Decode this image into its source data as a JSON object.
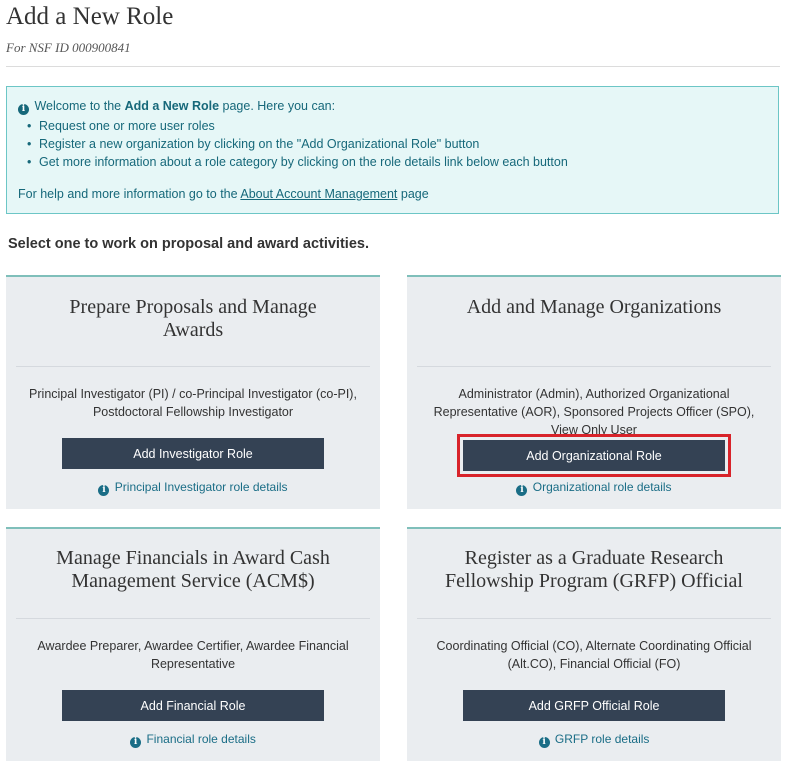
{
  "header": {
    "title": "Add a New Role",
    "subtitle": "For NSF ID 000900841"
  },
  "info": {
    "welcome_prefix": "Welcome to the ",
    "welcome_bold": "Add a New Role",
    "welcome_suffix": " page. Here you can:",
    "bullets": [
      "Request one or more user roles",
      "Register a new organization by clicking on the \"Add Organizational Role\" button",
      "Get more information about a role category by clicking on the role details link below each button"
    ],
    "help_prefix": "For help and more information go to the ",
    "help_link": "About Account Management",
    "help_suffix": " page",
    "icon": "info-circle-icon"
  },
  "section_heading": "Select one to work on proposal and award activities.",
  "cards": [
    {
      "title": "Prepare Proposals and Manage Awards",
      "description": "Principal Investigator (PI) / co-Principal Investigator (co-PI), Postdoctoral Fellowship Investigator",
      "button": "Add Investigator Role",
      "link": "Principal Investigator role details"
    },
    {
      "title": "Add and Manage Organizations",
      "description": "Administrator (Admin), Authorized Organizational Representative (AOR), Sponsored Projects Officer (SPO), View Only User",
      "button": "Add Organizational Role",
      "link": "Organizational role details"
    },
    {
      "title": "Manage Financials in Award Cash Management Service (ACM$)",
      "description": "Awardee Preparer, Awardee Certifier, Awardee Financial Representative",
      "button": "Add Financial Role",
      "link": "Financial role details"
    },
    {
      "title": "Register as a Graduate Research Fellowship Program (GRFP) Official",
      "description": "Coordinating Official (CO), Alternate Coordinating Official (Alt.CO), Financial Official (FO)",
      "button": "Add GRFP Official Role",
      "link": "GRFP role details"
    }
  ],
  "colors": {
    "button_bg": "#344254",
    "highlight_border": "#d8232a",
    "info_bg": "#e6f7f7",
    "info_border": "#6cc6c6",
    "link": "#1a6d86"
  }
}
